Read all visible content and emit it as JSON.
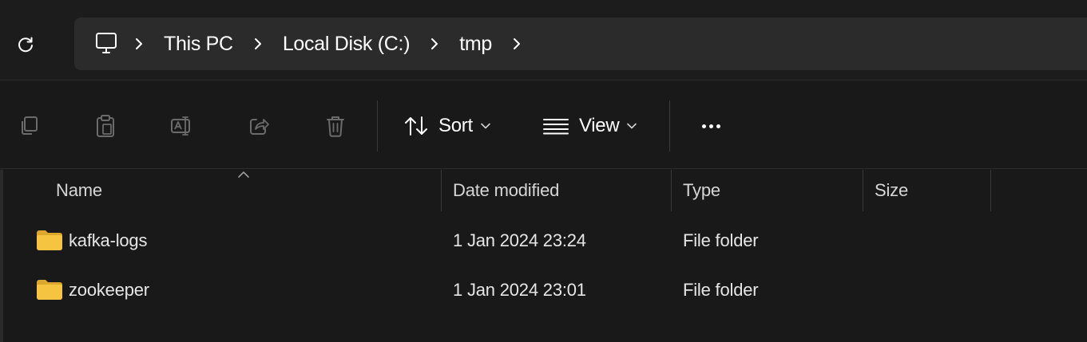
{
  "address_bar": {
    "breadcrumbs": [
      "This PC",
      "Local Disk (C:)",
      "tmp"
    ]
  },
  "toolbar": {
    "sort_label": "Sort",
    "view_label": "View"
  },
  "columns": {
    "name": "Name",
    "date_modified": "Date modified",
    "type": "Type",
    "size": "Size"
  },
  "files": [
    {
      "name": "kafka-logs",
      "date_modified": "1 Jan 2024 23:24",
      "type": "File folder",
      "size": ""
    },
    {
      "name": "zookeeper",
      "date_modified": "1 Jan 2024 23:01",
      "type": "File folder",
      "size": ""
    }
  ],
  "colors": {
    "folder": "#f5c542",
    "folder_dark": "#dba72c",
    "disabled_icon": "#6b6b6b",
    "text": "#ffffff"
  }
}
